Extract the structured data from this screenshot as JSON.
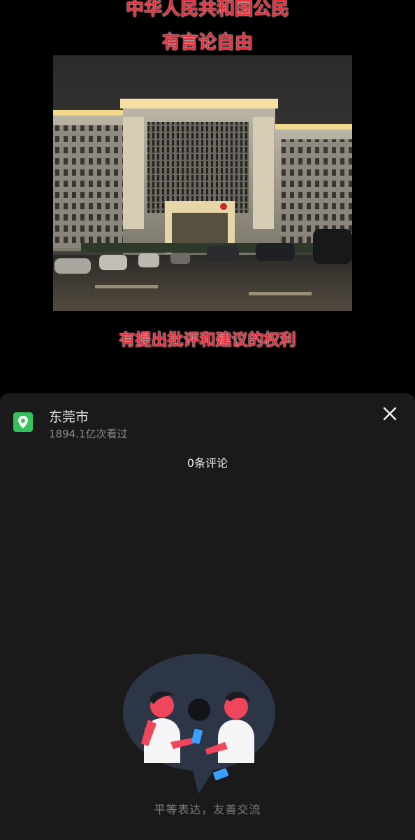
{
  "video": {
    "caption_line1": "中华人民共和国公民",
    "caption_line2": "有言论自由",
    "caption_line3": "有提出批评和建议的权利"
  },
  "comments_panel": {
    "location_name": "东莞市",
    "view_count": "1894.1亿次看过",
    "comment_count": "0条评论",
    "empty_slogan": "平等表达，友善交流",
    "close_icon": "close-icon",
    "location_icon": "map-pin-icon"
  },
  "colors": {
    "caption_red": "#ea2c3a",
    "panel_bg": "#1a1a1b",
    "location_green": "#34c35a",
    "bubble": "#2d3647",
    "accent_red": "#f0455a"
  }
}
